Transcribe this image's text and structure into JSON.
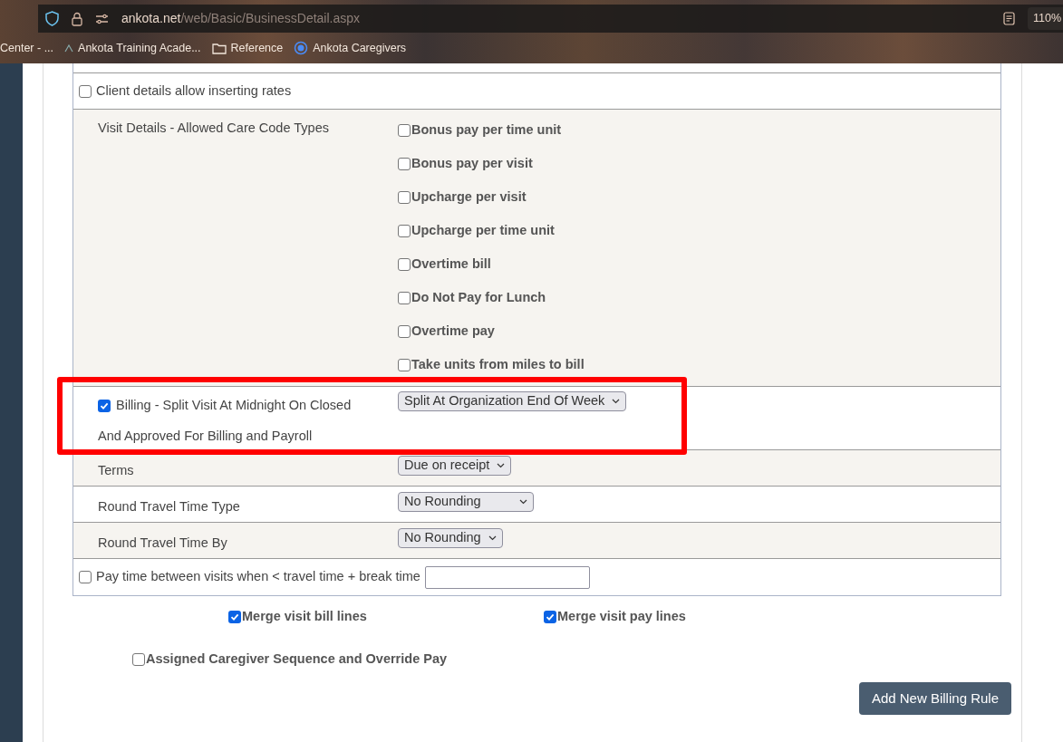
{
  "browser": {
    "url_host": "ankota.net",
    "url_path": "/web/Basic/BusinessDetail.aspx",
    "zoom": "110%"
  },
  "bookmarks": [
    {
      "label": "Center - ...",
      "kind": "plain"
    },
    {
      "label": "Ankota Training Acade...",
      "kind": "logo"
    },
    {
      "label": "Reference",
      "kind": "folder"
    },
    {
      "label": "Ankota Caregivers",
      "kind": "target"
    }
  ],
  "rows": [
    {
      "kind": "checkbox",
      "label": "Client details allow inserting rates",
      "checked": false,
      "shaded": false
    },
    {
      "kind": "options",
      "label": "Visit Details - Allowed Care Code Types",
      "shaded": true,
      "options": [
        {
          "label": "Bonus pay per time unit",
          "checked": false
        },
        {
          "label": "Bonus pay per visit",
          "checked": false
        },
        {
          "label": "Upcharge per visit",
          "checked": false
        },
        {
          "label": "Upcharge per time unit",
          "checked": false
        },
        {
          "label": "Overtime bill",
          "checked": false
        },
        {
          "label": "Do Not Pay for Lunch",
          "checked": false
        },
        {
          "label": "Overtime pay",
          "checked": false
        },
        {
          "label": "Take units from miles to bill",
          "checked": false
        }
      ]
    },
    {
      "kind": "checkbox-select",
      "label": "Billing - Split Visit At Midnight On Closed",
      "label_2": "And Approved For Billing and Payroll",
      "checked": true,
      "value": "Split At Organization End Of Week",
      "shaded": false,
      "highlighted": true
    },
    {
      "kind": "select",
      "label": "Terms",
      "value": "Due on receipt",
      "shaded": true
    },
    {
      "kind": "select",
      "label": "Round Travel Time Type",
      "value": "No Rounding",
      "shaded": false,
      "wide": true
    },
    {
      "kind": "select",
      "label": "Round Travel Time By",
      "value": "No Rounding",
      "shaded": true
    },
    {
      "kind": "checkbox-input",
      "label": "Pay time between visits when < travel time + break time",
      "checked": false,
      "shaded": false
    }
  ],
  "merge": [
    {
      "label": "Merge visit bill lines",
      "checked": true
    },
    {
      "label": "Merge visit pay lines",
      "checked": true
    }
  ],
  "assigned": {
    "label": "Assigned Caregiver Sequence and Override Pay",
    "checked": false
  },
  "add_button": "Add New Billing Rule"
}
